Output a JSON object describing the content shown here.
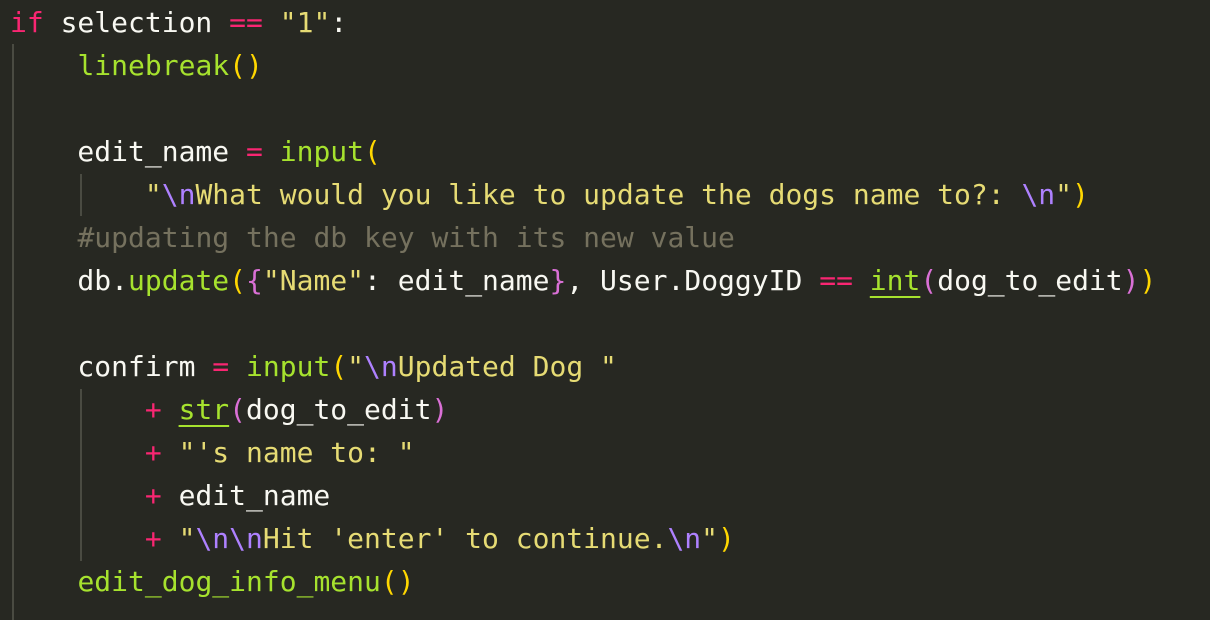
{
  "editor": {
    "background": "#272822",
    "theme_colors": {
      "keyword": "#f92672",
      "function": "#a6e22e",
      "string": "#e6db74",
      "escape": "#ae81ff",
      "comment": "#75715e",
      "text": "#f8f8f2",
      "bracket_level_1": "#ffd700",
      "bracket_level_2": "#da70d6",
      "bracket_level_3": "#179fff"
    },
    "lines": [
      {
        "tokens": [
          {
            "t": "if",
            "c": "keyword"
          },
          {
            "t": " selection ",
            "c": "plain"
          },
          {
            "t": "==",
            "c": "op"
          },
          {
            "t": " ",
            "c": "plain"
          },
          {
            "t": "\"1\"",
            "c": "string"
          },
          {
            "t": ":",
            "c": "plain"
          }
        ]
      },
      {
        "tokens": [
          {
            "t": "    ",
            "c": "plain"
          },
          {
            "t": "linebreak",
            "c": "func"
          },
          {
            "t": "()",
            "c": "paren1"
          }
        ]
      },
      {
        "tokens": []
      },
      {
        "tokens": [
          {
            "t": "    edit_name ",
            "c": "plain"
          },
          {
            "t": "=",
            "c": "op"
          },
          {
            "t": " ",
            "c": "plain"
          },
          {
            "t": "input",
            "c": "func"
          },
          {
            "t": "(",
            "c": "paren1"
          }
        ]
      },
      {
        "tokens": [
          {
            "t": "        ",
            "c": "plain"
          },
          {
            "t": "\"",
            "c": "string"
          },
          {
            "t": "\\n",
            "c": "escape"
          },
          {
            "t": "What would you like to update the dogs name to?: ",
            "c": "string"
          },
          {
            "t": "\\n",
            "c": "escape"
          },
          {
            "t": "\"",
            "c": "string"
          },
          {
            "t": ")",
            "c": "paren1"
          }
        ]
      },
      {
        "tokens": [
          {
            "t": "    ",
            "c": "plain"
          },
          {
            "t": "#updating the db key with its new value",
            "c": "comment"
          }
        ]
      },
      {
        "tokens": [
          {
            "t": "    db.",
            "c": "plain"
          },
          {
            "t": "update",
            "c": "func"
          },
          {
            "t": "(",
            "c": "paren1"
          },
          {
            "t": "{",
            "c": "paren2"
          },
          {
            "t": "\"Name\"",
            "c": "string"
          },
          {
            "t": ": edit_name",
            "c": "plain"
          },
          {
            "t": "}",
            "c": "paren2"
          },
          {
            "t": ", User.DoggyID ",
            "c": "plain"
          },
          {
            "t": "==",
            "c": "op"
          },
          {
            "t": " ",
            "c": "plain"
          },
          {
            "t": "int",
            "c": "builtin"
          },
          {
            "t": "(",
            "c": "paren2"
          },
          {
            "t": "dog_to_edit",
            "c": "plain"
          },
          {
            "t": ")",
            "c": "paren2"
          },
          {
            "t": ")",
            "c": "paren1"
          }
        ]
      },
      {
        "tokens": []
      },
      {
        "tokens": [
          {
            "t": "    confirm ",
            "c": "plain"
          },
          {
            "t": "=",
            "c": "op"
          },
          {
            "t": " ",
            "c": "plain"
          },
          {
            "t": "input",
            "c": "func"
          },
          {
            "t": "(",
            "c": "paren1"
          },
          {
            "t": "\"",
            "c": "string"
          },
          {
            "t": "\\n",
            "c": "escape"
          },
          {
            "t": "Updated Dog \"",
            "c": "string"
          }
        ]
      },
      {
        "tokens": [
          {
            "t": "        ",
            "c": "plain"
          },
          {
            "t": "+",
            "c": "op"
          },
          {
            "t": " ",
            "c": "plain"
          },
          {
            "t": "str",
            "c": "builtin"
          },
          {
            "t": "(",
            "c": "paren2"
          },
          {
            "t": "dog_to_edit",
            "c": "plain"
          },
          {
            "t": ")",
            "c": "paren2"
          }
        ]
      },
      {
        "tokens": [
          {
            "t": "        ",
            "c": "plain"
          },
          {
            "t": "+",
            "c": "op"
          },
          {
            "t": " ",
            "c": "plain"
          },
          {
            "t": "\"'s name to: \"",
            "c": "string"
          }
        ]
      },
      {
        "tokens": [
          {
            "t": "        ",
            "c": "plain"
          },
          {
            "t": "+",
            "c": "op"
          },
          {
            "t": " edit_name",
            "c": "plain"
          }
        ]
      },
      {
        "tokens": [
          {
            "t": "        ",
            "c": "plain"
          },
          {
            "t": "+",
            "c": "op"
          },
          {
            "t": " ",
            "c": "plain"
          },
          {
            "t": "\"",
            "c": "string"
          },
          {
            "t": "\\n\\n",
            "c": "escape"
          },
          {
            "t": "Hit 'enter' to continue.",
            "c": "string"
          },
          {
            "t": "\\n",
            "c": "escape"
          },
          {
            "t": "\"",
            "c": "string"
          },
          {
            "t": ")",
            "c": "paren1"
          }
        ]
      },
      {
        "tokens": [
          {
            "t": "    ",
            "c": "plain"
          },
          {
            "t": "edit_dog_info_menu",
            "c": "func"
          },
          {
            "t": "()",
            "c": "paren1"
          }
        ]
      }
    ]
  }
}
